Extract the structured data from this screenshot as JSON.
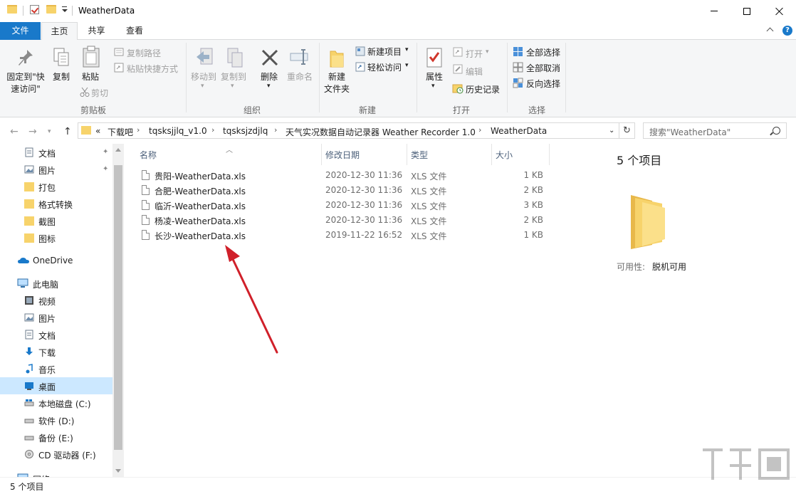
{
  "window": {
    "title": "WeatherData"
  },
  "ribbon_tabs": [
    "文件",
    "主页",
    "共享",
    "查看"
  ],
  "ribbon": {
    "clipboard": {
      "pin_label_1": "固定到\"快",
      "pin_label_2": "速访问\"",
      "copy": "复制",
      "paste": "粘贴",
      "copy_path": "复制路径",
      "paste_shortcut": "粘贴快捷方式",
      "cut": "剪切",
      "group": "剪贴板"
    },
    "organize": {
      "move_to": "移动到",
      "copy_to": "复制到",
      "delete": "删除",
      "rename": "重命名",
      "group": "组织"
    },
    "new": {
      "new_folder_1": "新建",
      "new_folder_2": "文件夹",
      "new_item": "新建项目",
      "easy_access": "轻松访问",
      "group": "新建"
    },
    "open": {
      "properties": "属性",
      "open": "打开",
      "edit": "编辑",
      "history": "历史记录",
      "group": "打开"
    },
    "select": {
      "select_all": "全部选择",
      "select_none": "全部取消",
      "invert": "反向选择",
      "group": "选择"
    }
  },
  "address": {
    "prefix": "«",
    "crumbs": [
      "下载吧",
      "tqsksjjlq_v1.0",
      "tqsksjzdjlq",
      "天气实况数据自动记录器 Weather Recorder 1.0",
      "WeatherData"
    ]
  },
  "search": {
    "placeholder": "搜索\"WeatherData\""
  },
  "nav": {
    "quick": [
      "文档",
      "图片",
      "打包",
      "格式转换",
      "截图",
      "图标"
    ],
    "onedrive": "OneDrive",
    "pc": "此电脑",
    "pc_items": [
      "视频",
      "图片",
      "文档",
      "下载",
      "音乐",
      "桌面",
      "本地磁盘 (C:)",
      "软件 (D:)",
      "备份 (E:)",
      "CD 驱动器 (F:)"
    ],
    "network": "网络"
  },
  "columns": [
    "名称",
    "修改日期",
    "类型",
    "大小"
  ],
  "files": [
    {
      "name": "贵阳-WeatherData.xls",
      "date": "2020-12-30 11:36",
      "type": "XLS 文件",
      "size": "1 KB"
    },
    {
      "name": "合肥-WeatherData.xls",
      "date": "2020-12-30 11:36",
      "type": "XLS 文件",
      "size": "2 KB"
    },
    {
      "name": "临沂-WeatherData.xls",
      "date": "2020-12-30 11:36",
      "type": "XLS 文件",
      "size": "3 KB"
    },
    {
      "name": "杨凌-WeatherData.xls",
      "date": "2020-12-30 11:36",
      "type": "XLS 文件",
      "size": "2 KB"
    },
    {
      "name": "长沙-WeatherData.xls",
      "date": "2019-11-22 16:52",
      "type": "XLS 文件",
      "size": "1 KB"
    }
  ],
  "details": {
    "count": "5 个项目",
    "availability_label": "可用性:",
    "availability_value": "脱机可用"
  },
  "status": {
    "text": "5 个项目"
  },
  "colors": {
    "accent": "#1979ca",
    "selection": "#cce8ff",
    "arrow": "#d0202a",
    "folder": "#f7d36b"
  }
}
